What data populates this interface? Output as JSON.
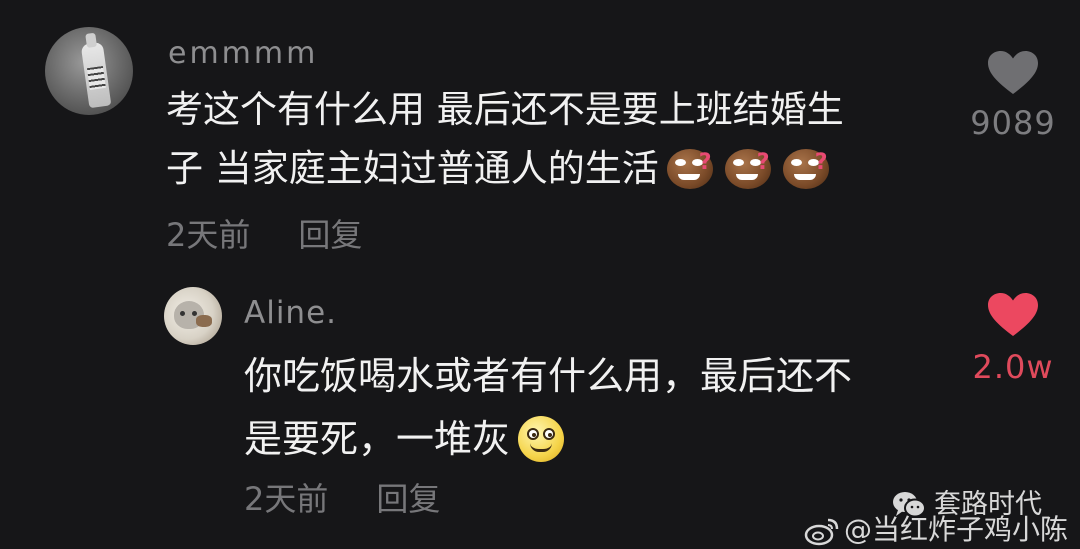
{
  "comments": [
    {
      "username": "emmmm",
      "text_lines": [
        "考这个有什么用 最后还不是要上班结婚生",
        "子 当家庭主妇过普通人的生活"
      ],
      "emojis": [
        "smirk-question-emoji",
        "smirk-question-emoji",
        "smirk-question-emoji"
      ],
      "emoji_question_mark": "?",
      "time": "2天前",
      "reply_label": "回复",
      "likes": "9089",
      "liked": false,
      "heart_color": "#6f6f72"
    },
    {
      "username": "Aline.",
      "text_lines": [
        "你吃饭喝水或者有什么用，最后还不",
        "是要死，一堆灰"
      ],
      "emojis": [
        "smile-emoji"
      ],
      "time": "2天前",
      "reply_label": "回复",
      "likes": "2.0w",
      "liked": true,
      "heart_color": "#ec4860"
    }
  ],
  "watermarks": {
    "wechat_account": "套路时代",
    "weibo_account": "@当红炸子鸡小陈"
  }
}
